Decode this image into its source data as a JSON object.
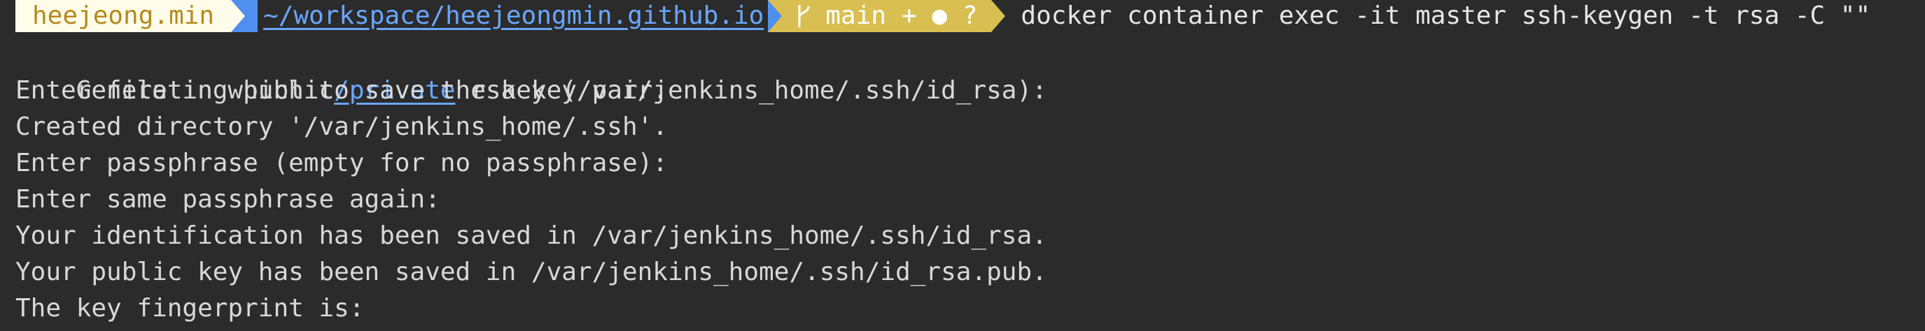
{
  "prompt": {
    "user": "heejeong.min",
    "path": "~/workspace/heejeongmin.github.io",
    "git_branch": "main",
    "git_status_symbols": "+ ● ?",
    "command": "docker container exec -it master ssh-keygen -t rsa -C \"\""
  },
  "output": {
    "line1_prefix": "Generating public",
    "line1_link": "/private",
    "line1_suffix": " rsa key pair.",
    "lines": [
      "Enter file in which to save the key (/var/jenkins_home/.ssh/id_rsa):",
      "Created directory '/var/jenkins_home/.ssh'.",
      "Enter passphrase (empty for no passphrase):",
      "Enter same passphrase again:",
      "Your identification has been saved in /var/jenkins_home/.ssh/id_rsa.",
      "Your public key has been saved in /var/jenkins_home/.ssh/id_rsa.pub.",
      "The key fingerprint is:"
    ]
  },
  "colors": {
    "background": "#2b2b2b",
    "user_segment_bg": "#fffdea",
    "user_segment_fg": "#b5891c",
    "path_segment_accent": "#4f8ff0",
    "path_text": "#6aa7ff",
    "git_segment_bg": "#d9bf52",
    "text": "#d8d8d8"
  },
  "icons": {
    "branch": "git-branch-icon"
  }
}
